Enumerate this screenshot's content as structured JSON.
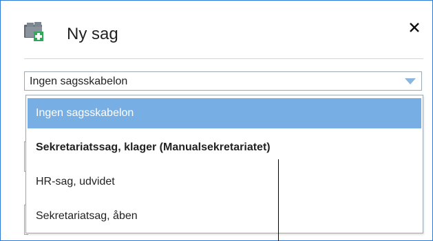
{
  "dialog": {
    "title": "Ny sag",
    "title_icon": "case-folder-add-icon",
    "close_glyph": "✕",
    "close_icon": "close-icon"
  },
  "template_select": {
    "value": "Ingen sagsskabelon",
    "arrow_icon": "chevron-down-icon"
  },
  "dropdown": {
    "options": [
      {
        "label": "Ingen sagsskabelon",
        "selected": true,
        "bold": false
      },
      {
        "label": "Sekretariatssag, klager (Manualsekretariatet)",
        "selected": false,
        "bold": true
      },
      {
        "label": "HR-sag, udvidet",
        "selected": false,
        "bold": false
      },
      {
        "label": "Sekretariatsag, åben",
        "selected": false,
        "bold": false
      }
    ]
  },
  "colors": {
    "accent_border": "#2b7bd6",
    "selected_background": "#77aee3",
    "arrow": "#8db6de",
    "icon_plus": "#2fa85a"
  }
}
